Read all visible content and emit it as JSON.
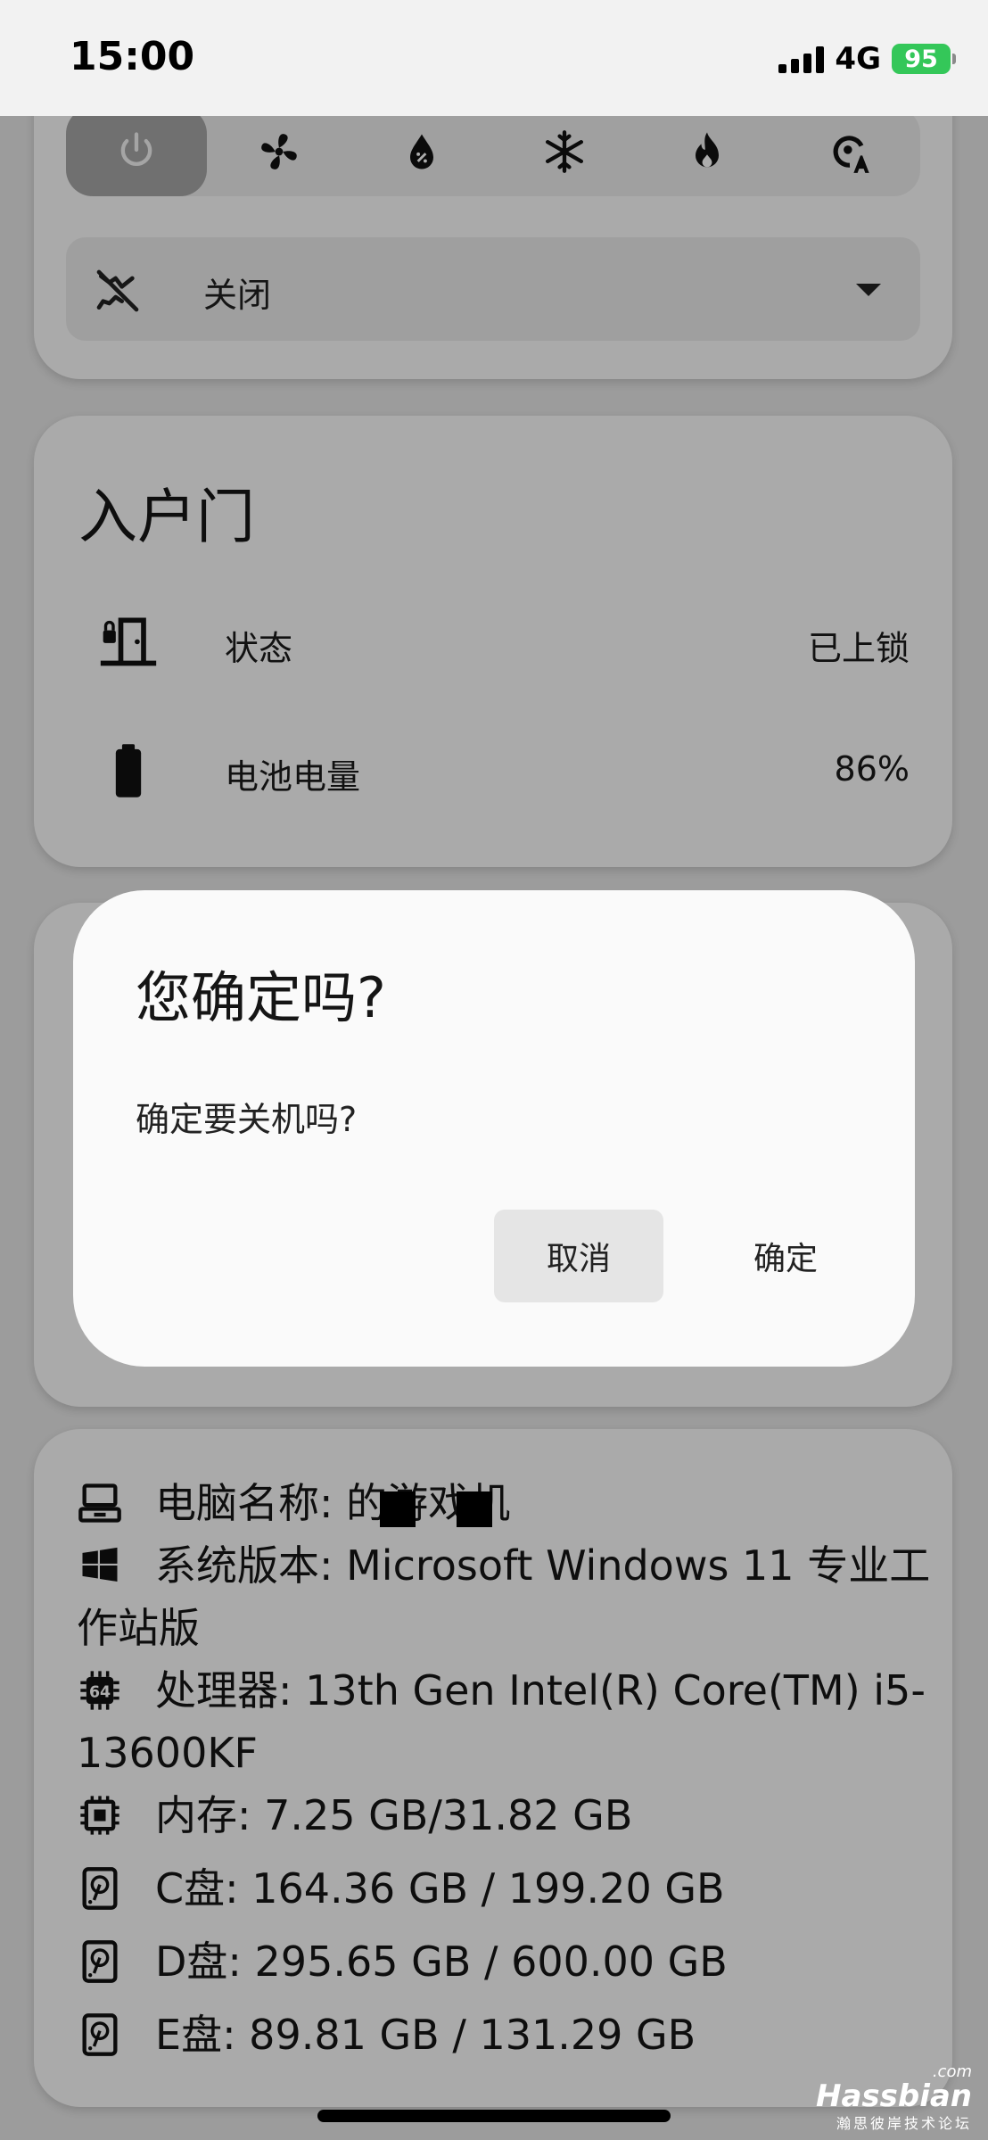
{
  "status_bar": {
    "time": "15:00",
    "network": "4G",
    "battery": "95"
  },
  "mode_bar": {
    "modes": [
      {
        "icon": "power-icon",
        "active": true
      },
      {
        "icon": "fan-icon",
        "active": false
      },
      {
        "icon": "water-drop-icon",
        "active": false
      },
      {
        "icon": "snowflake-icon",
        "active": false
      },
      {
        "icon": "flame-icon",
        "active": false
      },
      {
        "icon": "auto-mode-icon",
        "active": false
      }
    ]
  },
  "preset_select": {
    "icon": "motion-off-icon",
    "value": "关闭"
  },
  "door_card": {
    "title": "入户门",
    "rows": [
      {
        "icon": "door-lock-icon",
        "label": "状态",
        "value": "已上锁"
      },
      {
        "icon": "battery-icon",
        "label": "电池电量",
        "value": "86%"
      }
    ]
  },
  "dialog": {
    "title": "您确定吗?",
    "message": "确定要关机吗?",
    "cancel_label": "取消",
    "confirm_label": "确定"
  },
  "pc_card": {
    "lines": [
      {
        "icon": "laptop-icon",
        "text": "电脑名称:        的游戏机"
      },
      {
        "icon": "windows-icon",
        "text": "系统版本: Microsoft Windows 11 专业工作站版"
      },
      {
        "icon": "cpu-64-icon",
        "text": "处理器: 13th Gen Intel(R) Core(TM) i5-13600KF"
      },
      {
        "icon": "memory-chip-icon",
        "text": "内存: 7.25 GB/31.82 GB"
      },
      {
        "icon": "harddisk-icon",
        "text": "C盘:  164.36 GB / 199.20 GB"
      },
      {
        "icon": "harddisk-icon",
        "text": "D盘:  295.65 GB / 600.00 GB"
      },
      {
        "icon": "harddisk-icon",
        "text": "E盘:  89.81 GB / 131.29 GB"
      }
    ]
  },
  "watermark": {
    "domain": ".com",
    "brand": "Hassbian",
    "tagline": "瀚思彼岸技术论坛"
  }
}
